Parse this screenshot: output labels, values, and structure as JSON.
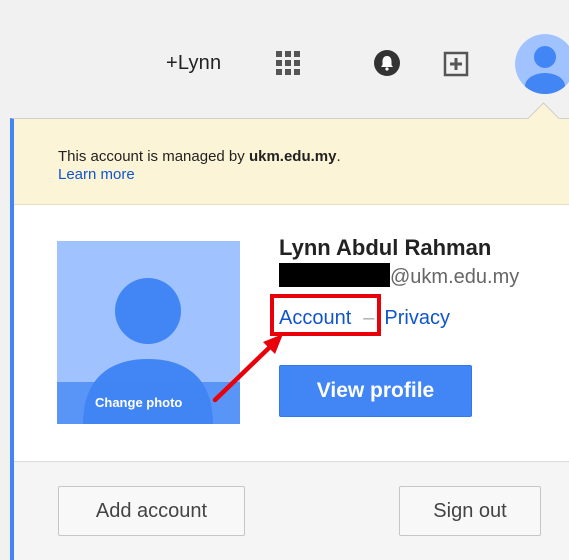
{
  "header": {
    "plus_user": "+Lynn",
    "icons": [
      "apps-grid-icon",
      "notifications-bell-icon",
      "share-plus-icon",
      "avatar-icon"
    ]
  },
  "notice": {
    "prefix": "This account is managed by ",
    "domain": "ukm.edu.my",
    "suffix": ".",
    "learn_more": "Learn more"
  },
  "profile": {
    "name": "Lynn Abdul Rahman",
    "email_domain": "@ukm.edu.my",
    "change_photo": "Change photo",
    "links": {
      "account": "Account",
      "separator": "–",
      "privacy": "Privacy"
    },
    "view_profile": "View profile"
  },
  "footer": {
    "add_account": "Add account",
    "sign_out": "Sign out"
  },
  "colors": {
    "accent_blue": "#4285f4",
    "link_blue": "#1155cc",
    "notice_bg": "#fcf4d6",
    "highlight_red": "#e8000a",
    "photo_bg": "#a0c3ff"
  }
}
